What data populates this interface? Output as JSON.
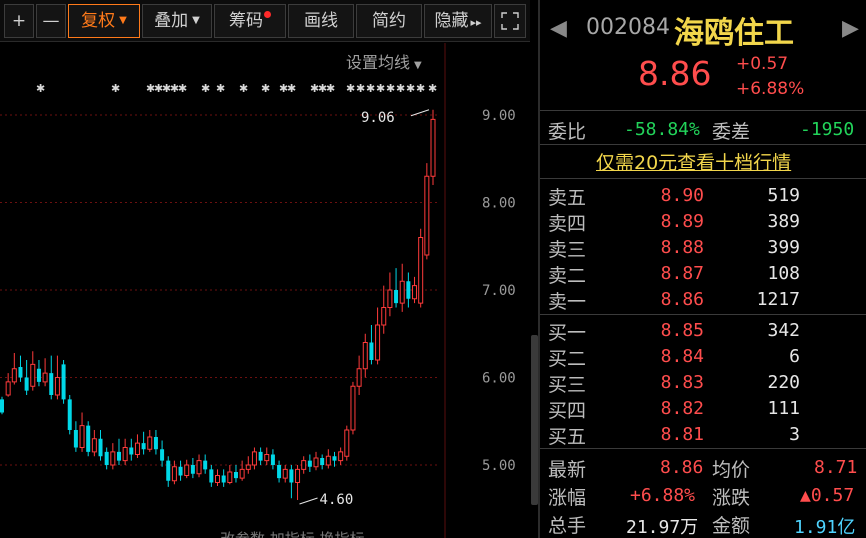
{
  "toolbar": {
    "plus": "+",
    "minus": "—",
    "restore_rights": "复权",
    "overlay": "叠加",
    "chips": "筹码",
    "draw_line": "画线",
    "brief": "简约",
    "hide": "隐藏",
    "hide_arrows": "▸▸",
    "fullscreen_icon": "fullscreen-icon"
  },
  "chart": {
    "set_ma_label": "设置均线",
    "y_ticks": [
      "9.00",
      "8.00",
      "7.00",
      "6.00",
      "5.00"
    ],
    "high_annotation": "9.06",
    "low_annotation": "4.60",
    "bottom_tabs": "改参数  加指标  换指标",
    "colors": {
      "up": "#ff3b3b",
      "down": "#00d8e8",
      "grid": "#6b1010",
      "axis_text": "#9a9a9a"
    }
  },
  "chart_data": {
    "type": "candlestick",
    "y_ticks": [
      9.0,
      8.0,
      7.0,
      6.0,
      5.0
    ],
    "ylim": [
      4.4,
      9.2
    ],
    "high": 9.06,
    "low": 4.6,
    "ohlc": [
      [
        5.75,
        5.6,
        5.78,
        5.58
      ],
      [
        5.8,
        5.95,
        6.05,
        5.78
      ],
      [
        5.95,
        6.1,
        6.28,
        5.92
      ],
      [
        6.12,
        6.0,
        6.25,
        5.95
      ],
      [
        6.0,
        5.85,
        6.2,
        5.8
      ],
      [
        5.9,
        6.15,
        6.3,
        5.85
      ],
      [
        6.1,
        5.95,
        6.2,
        5.9
      ],
      [
        5.95,
        6.05,
        6.22,
        5.9
      ],
      [
        6.05,
        5.8,
        6.25,
        5.75
      ],
      [
        5.8,
        6.0,
        6.25,
        5.75
      ],
      [
        6.15,
        5.75,
        6.2,
        5.7
      ],
      [
        5.75,
        5.4,
        5.8,
        5.35
      ],
      [
        5.4,
        5.2,
        5.5,
        5.15
      ],
      [
        5.2,
        5.45,
        5.6,
        5.15
      ],
      [
        5.45,
        5.15,
        5.5,
        5.1
      ],
      [
        5.15,
        5.3,
        5.4,
        5.1
      ],
      [
        5.3,
        5.1,
        5.4,
        5.05
      ],
      [
        5.15,
        5.0,
        5.2,
        4.95
      ],
      [
        5.0,
        5.15,
        5.25,
        4.95
      ],
      [
        5.15,
        5.05,
        5.3,
        5.0
      ],
      [
        5.05,
        5.2,
        5.3,
        5.0
      ],
      [
        5.2,
        5.12,
        5.3,
        5.05
      ],
      [
        5.12,
        5.25,
        5.35,
        5.08
      ],
      [
        5.25,
        5.18,
        5.38,
        5.12
      ],
      [
        5.18,
        5.32,
        5.4,
        5.15
      ],
      [
        5.32,
        5.18,
        5.4,
        5.12
      ],
      [
        5.18,
        5.05,
        5.28,
        4.98
      ],
      [
        5.05,
        4.82,
        5.1,
        4.75
      ],
      [
        4.82,
        4.98,
        5.05,
        4.78
      ],
      [
        4.98,
        4.88,
        5.05,
        4.82
      ],
      [
        4.88,
        5.0,
        5.06,
        4.85
      ],
      [
        5.0,
        4.9,
        5.08,
        4.85
      ],
      [
        4.9,
        5.05,
        5.12,
        4.86
      ],
      [
        5.05,
        4.95,
        5.12,
        4.9
      ],
      [
        4.95,
        4.8,
        5.0,
        4.75
      ],
      [
        4.8,
        4.88,
        4.95,
        4.76
      ],
      [
        4.88,
        4.8,
        4.95,
        4.75
      ],
      [
        4.8,
        4.92,
        5.0,
        4.78
      ],
      [
        4.92,
        4.85,
        5.0,
        4.8
      ],
      [
        4.85,
        4.95,
        5.05,
        4.82
      ],
      [
        4.95,
        5.0,
        5.1,
        4.9
      ],
      [
        5.0,
        5.15,
        5.2,
        4.95
      ],
      [
        5.15,
        5.05,
        5.2,
        5.0
      ],
      [
        5.05,
        5.12,
        5.2,
        5.0
      ],
      [
        5.12,
        5.0,
        5.18,
        4.95
      ],
      [
        5.0,
        4.85,
        5.05,
        4.8
      ],
      [
        4.85,
        4.95,
        5.0,
        4.8
      ],
      [
        4.95,
        4.8,
        5.0,
        4.62
      ],
      [
        4.8,
        4.95,
        5.0,
        4.6
      ],
      [
        4.95,
        5.05,
        5.1,
        4.9
      ],
      [
        5.05,
        4.98,
        5.12,
        4.92
      ],
      [
        4.98,
        5.08,
        5.15,
        4.94
      ],
      [
        5.08,
        5.0,
        5.12,
        4.95
      ],
      [
        5.0,
        5.1,
        5.18,
        4.96
      ],
      [
        5.1,
        5.05,
        5.15,
        4.98
      ],
      [
        5.05,
        5.15,
        5.2,
        5.0
      ],
      [
        5.1,
        5.4,
        5.45,
        5.05
      ],
      [
        5.4,
        5.9,
        5.95,
        5.35
      ],
      [
        5.9,
        6.1,
        6.25,
        5.8
      ],
      [
        6.1,
        6.4,
        6.5,
        6.0
      ],
      [
        6.4,
        6.2,
        6.6,
        6.15
      ],
      [
        6.2,
        6.6,
        6.8,
        6.15
      ],
      [
        6.6,
        6.8,
        7.05,
        6.5
      ],
      [
        6.8,
        7.0,
        7.2,
        6.7
      ],
      [
        7.0,
        6.85,
        7.25,
        6.8
      ],
      [
        6.85,
        7.1,
        7.3,
        6.75
      ],
      [
        7.1,
        6.9,
        7.2,
        6.8
      ],
      [
        6.9,
        7.05,
        7.15,
        6.85
      ],
      [
        6.85,
        7.6,
        7.7,
        6.8
      ],
      [
        7.4,
        8.3,
        8.45,
        7.35
      ],
      [
        8.3,
        8.95,
        9.06,
        8.2
      ]
    ]
  },
  "quote": {
    "code": "002084",
    "name": "海鸥住工",
    "price": "8.86",
    "change": "+0.57",
    "change_pct": "+6.88%"
  },
  "ratio": {
    "label": "委比",
    "value": "-58.84%",
    "diff_label": "委差",
    "diff_value": "-1950"
  },
  "promo": "仅需20元查看十档行情",
  "asks": [
    {
      "name": "卖五",
      "price": "8.90",
      "vol": "519"
    },
    {
      "name": "卖四",
      "price": "8.89",
      "vol": "389"
    },
    {
      "name": "卖三",
      "price": "8.88",
      "vol": "399"
    },
    {
      "name": "卖二",
      "price": "8.87",
      "vol": "108"
    },
    {
      "name": "卖一",
      "price": "8.86",
      "vol": "1217"
    }
  ],
  "bids": [
    {
      "name": "买一",
      "price": "8.85",
      "vol": "342"
    },
    {
      "name": "买二",
      "price": "8.84",
      "vol": "6"
    },
    {
      "name": "买三",
      "price": "8.83",
      "vol": "220"
    },
    {
      "name": "买四",
      "price": "8.82",
      "vol": "111"
    },
    {
      "name": "买五",
      "price": "8.81",
      "vol": "3"
    }
  ],
  "stats": {
    "latest_label": "最新",
    "latest": "8.86",
    "avg_label": "均价",
    "avg": "8.71",
    "pct_label": "涨幅",
    "pct": "+6.88%",
    "chg_label": "涨跌",
    "chg": "▲0.57",
    "vol_label": "总手",
    "vol": "21.97万",
    "amt_label": "金额",
    "amt": "1.91亿"
  }
}
